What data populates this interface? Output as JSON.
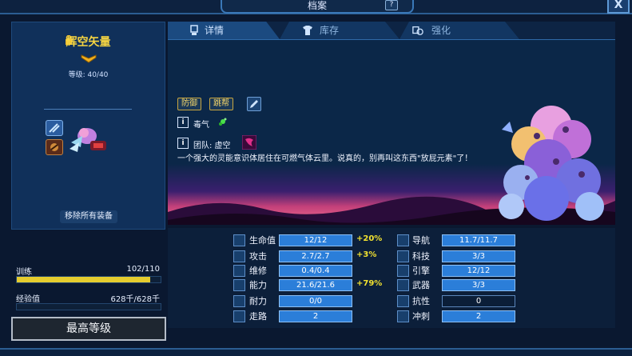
{
  "window": {
    "title": "档案",
    "help_label": "?",
    "close_label": "X"
  },
  "hero": {
    "name": "辉空矢量",
    "level_text": "等级: 40/40",
    "remove_equipment_label": "移除所有装备"
  },
  "training": {
    "label": "训练",
    "value": "102/110",
    "progress": 0.927
  },
  "experience": {
    "label": "经验值",
    "value": "628千/628千"
  },
  "max_level_label": "最高等级",
  "tabs": [
    {
      "label": "详情",
      "icon": "portrait-icon"
    },
    {
      "label": "库存",
      "icon": "shirt-icon"
    },
    {
      "label": "强化",
      "icon": "upgrade-icon"
    }
  ],
  "details": {
    "tags": [
      "防御",
      "跳帮"
    ],
    "info_icon_label": "i",
    "poison_label": "毒气",
    "team_label": "团队: 虚空",
    "description": "一个强大的灵能意识体居住在可燃气体云里。说真的，别再叫这东西\"放屁元素\"了！"
  },
  "stats_left": [
    {
      "label": "生命值",
      "value": "12/12",
      "bonus": "+20%",
      "icon": "heart-icon"
    },
    {
      "label": "攻击",
      "value": "2.7/2.7",
      "bonus": "+3%",
      "icon": "sword-icon"
    },
    {
      "label": "维修",
      "value": "0.4/0.4",
      "bonus": "",
      "icon": "wrench-icon"
    },
    {
      "label": "能力",
      "value": "21.6/21.6",
      "bonus": "+79%",
      "icon": "ability-icon"
    },
    {
      "label": "耐力",
      "value": "0/0",
      "bonus": "",
      "icon": "boot-icon"
    },
    {
      "label": "走路",
      "value": "2",
      "bonus": "",
      "icon": "walk-icon"
    }
  ],
  "stats_right": [
    {
      "label": "导航",
      "value": "11.7/11.7",
      "icon": "navigation-icon"
    },
    {
      "label": "科技",
      "value": "3/3",
      "icon": "flask-icon"
    },
    {
      "label": "引擎",
      "value": "12/12",
      "icon": "engine-icon"
    },
    {
      "label": "武器",
      "value": "3/3",
      "icon": "crosshair-icon"
    },
    {
      "label": "抗性",
      "value": "0",
      "icon": "flame-icon"
    },
    {
      "label": "冲刺",
      "value": "2",
      "icon": "sprint-icon"
    }
  ],
  "colors": {
    "accent_yellow": "#f5d442",
    "stat_blue": "#2b7ed9",
    "bonus_yellow": "#f2e230",
    "bg": "#0a1830"
  }
}
